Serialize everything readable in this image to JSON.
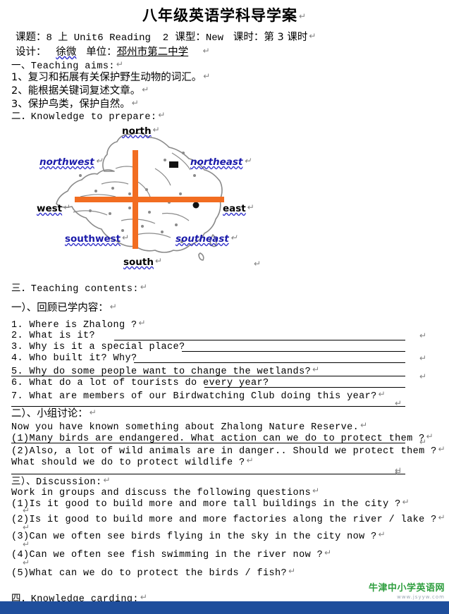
{
  "document": {
    "title": "八年级英语学科导学案",
    "pilcrow": "↵"
  },
  "header": {
    "line1": {
      "topic_label": "课题：",
      "topic_value": "8 上 Unit6 Reading  2",
      "type_label": "课型：",
      "type_value": "New",
      "period_label": "课时：",
      "period_value": "第 3 课时"
    },
    "line2": {
      "designer_label": "设计：",
      "designer_value": "徐微",
      "unit_label": "单位：",
      "unit_value": "邳州市第二中学"
    }
  },
  "sections": {
    "aims": {
      "heading": "一、Teaching aims:",
      "items": [
        "1、复习和拓展有关保护野生动物的词汇。",
        "2、能根据关键词复述文章。",
        "3、保护鸟类，保护自然。"
      ]
    },
    "knowledge_prepare": {
      "heading": "二．Knowledge to prepare:"
    },
    "teaching_contents": {
      "heading": "三．Teaching contents:"
    },
    "review": {
      "heading": "一）、回顾已学内容：",
      "questions": [
        "1. Where is Zhalong ?",
        "2. What is it?",
        "3. Why is it a special place?",
        "4. Who built it? Why?",
        "5. Why do some people want to change the wetlands?",
        "6. What do a lot of tourists do every year?",
        "7. What are members of our Birdwatching Club doing this year?"
      ]
    },
    "group_discussion": {
      "heading": "二）、小组讨论：",
      "intro": "Now you have known something about Zhalong Nature Reserve.",
      "items": [
        "(1)Many birds are endangered. What action can we do to protect them ?",
        "(2)Also, a lot of wild animals are in danger.. Should we protect them ?",
        "What should we do to protect wildlife ?"
      ]
    },
    "discussion": {
      "heading": "三）、Discussion:",
      "intro": "Work in groups and discuss the following questions",
      "items": [
        "(1)Is it good to build more and more tall buildings in the city ?",
        "(2)Is it good to build more and more factories along the river / lake ?",
        "(3)Can we often see birds flying in the sky in the city now ?",
        "(4)Can we often see fish swimming in the river now ?",
        "(5)What can we do to protect the birds / fish?"
      ]
    },
    "knowledge_carding": {
      "heading": "四．Knowledge carding:"
    }
  },
  "map_figure": {
    "cross_color": "#F26D21",
    "map_outline_color": "#8a8a8a",
    "labels": [
      {
        "text": "north",
        "style": "black"
      },
      {
        "text": "northwest",
        "style": "blue-italic"
      },
      {
        "text": "northeast",
        "style": "blue-italic"
      },
      {
        "text": "west",
        "style": "black"
      },
      {
        "text": "east",
        "style": "black"
      },
      {
        "text": "southwest",
        "style": "blue"
      },
      {
        "text": "southeast",
        "style": "blue-italic"
      },
      {
        "text": "south",
        "style": "black"
      }
    ]
  },
  "footer": {
    "watermark_text": "牛津中小学英语网",
    "watermark_url": "www.jsyyw.com",
    "bar_color": "#1F4E9C",
    "watermark_color": "#2E9E3E"
  }
}
